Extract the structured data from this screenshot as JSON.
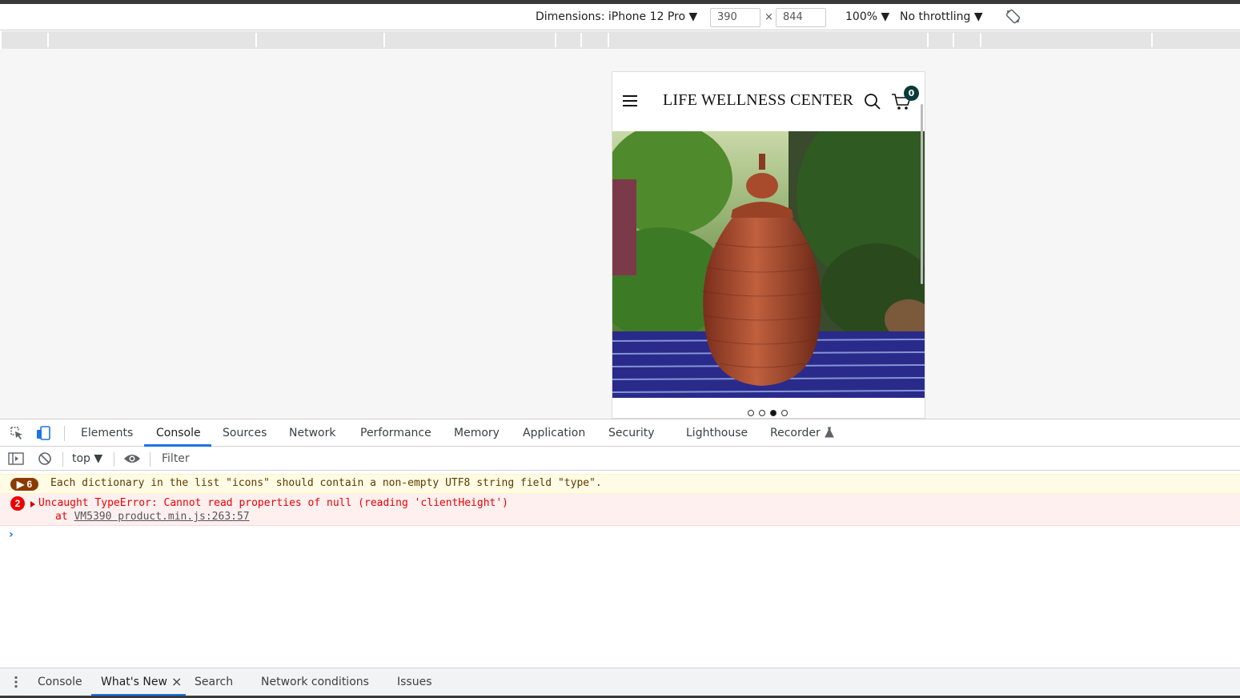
{
  "device_toolbar": {
    "dimensions_label": "Dimensions: iPhone 12 Pro ▼",
    "width": "390",
    "times": "×",
    "height": "844",
    "zoom": "100% ▼",
    "throttling": "No throttling ▼"
  },
  "phone": {
    "brand": "LIFE WELLNESS CENTER",
    "cart_count": "0",
    "carousel": {
      "total": 4,
      "active_index": 2
    }
  },
  "devtools_tabs": [
    "Elements",
    "Console",
    "Sources",
    "Network",
    "Performance",
    "Memory",
    "Application",
    "Security",
    "Lighthouse",
    "Recorder"
  ],
  "console_bar": {
    "context": "top ▼",
    "filter_placeholder": "Filter"
  },
  "messages": {
    "warning": {
      "count": "▶ 6",
      "text": "Each dictionary in the list \"icons\" should contain a non-empty UTF8 string field \"type\"."
    },
    "error": {
      "count": "2",
      "text": "Uncaught TypeError: Cannot read properties of null (reading 'clientHeight')",
      "stack_prefix": "at ",
      "stack_link": "VM5390 product.min.js:263:57"
    },
    "prompt": "›"
  },
  "drawer_tabs": {
    "console": "Console",
    "whats_new": "What's New",
    "close": "×",
    "search": "Search",
    "network_conditions": "Network conditions",
    "issues": "Issues"
  },
  "colors": {
    "accent": "#1a73e8",
    "badge_dark": "#0a3a3a",
    "error_red": "#e00000",
    "warning_brown": "#8a3b00"
  }
}
